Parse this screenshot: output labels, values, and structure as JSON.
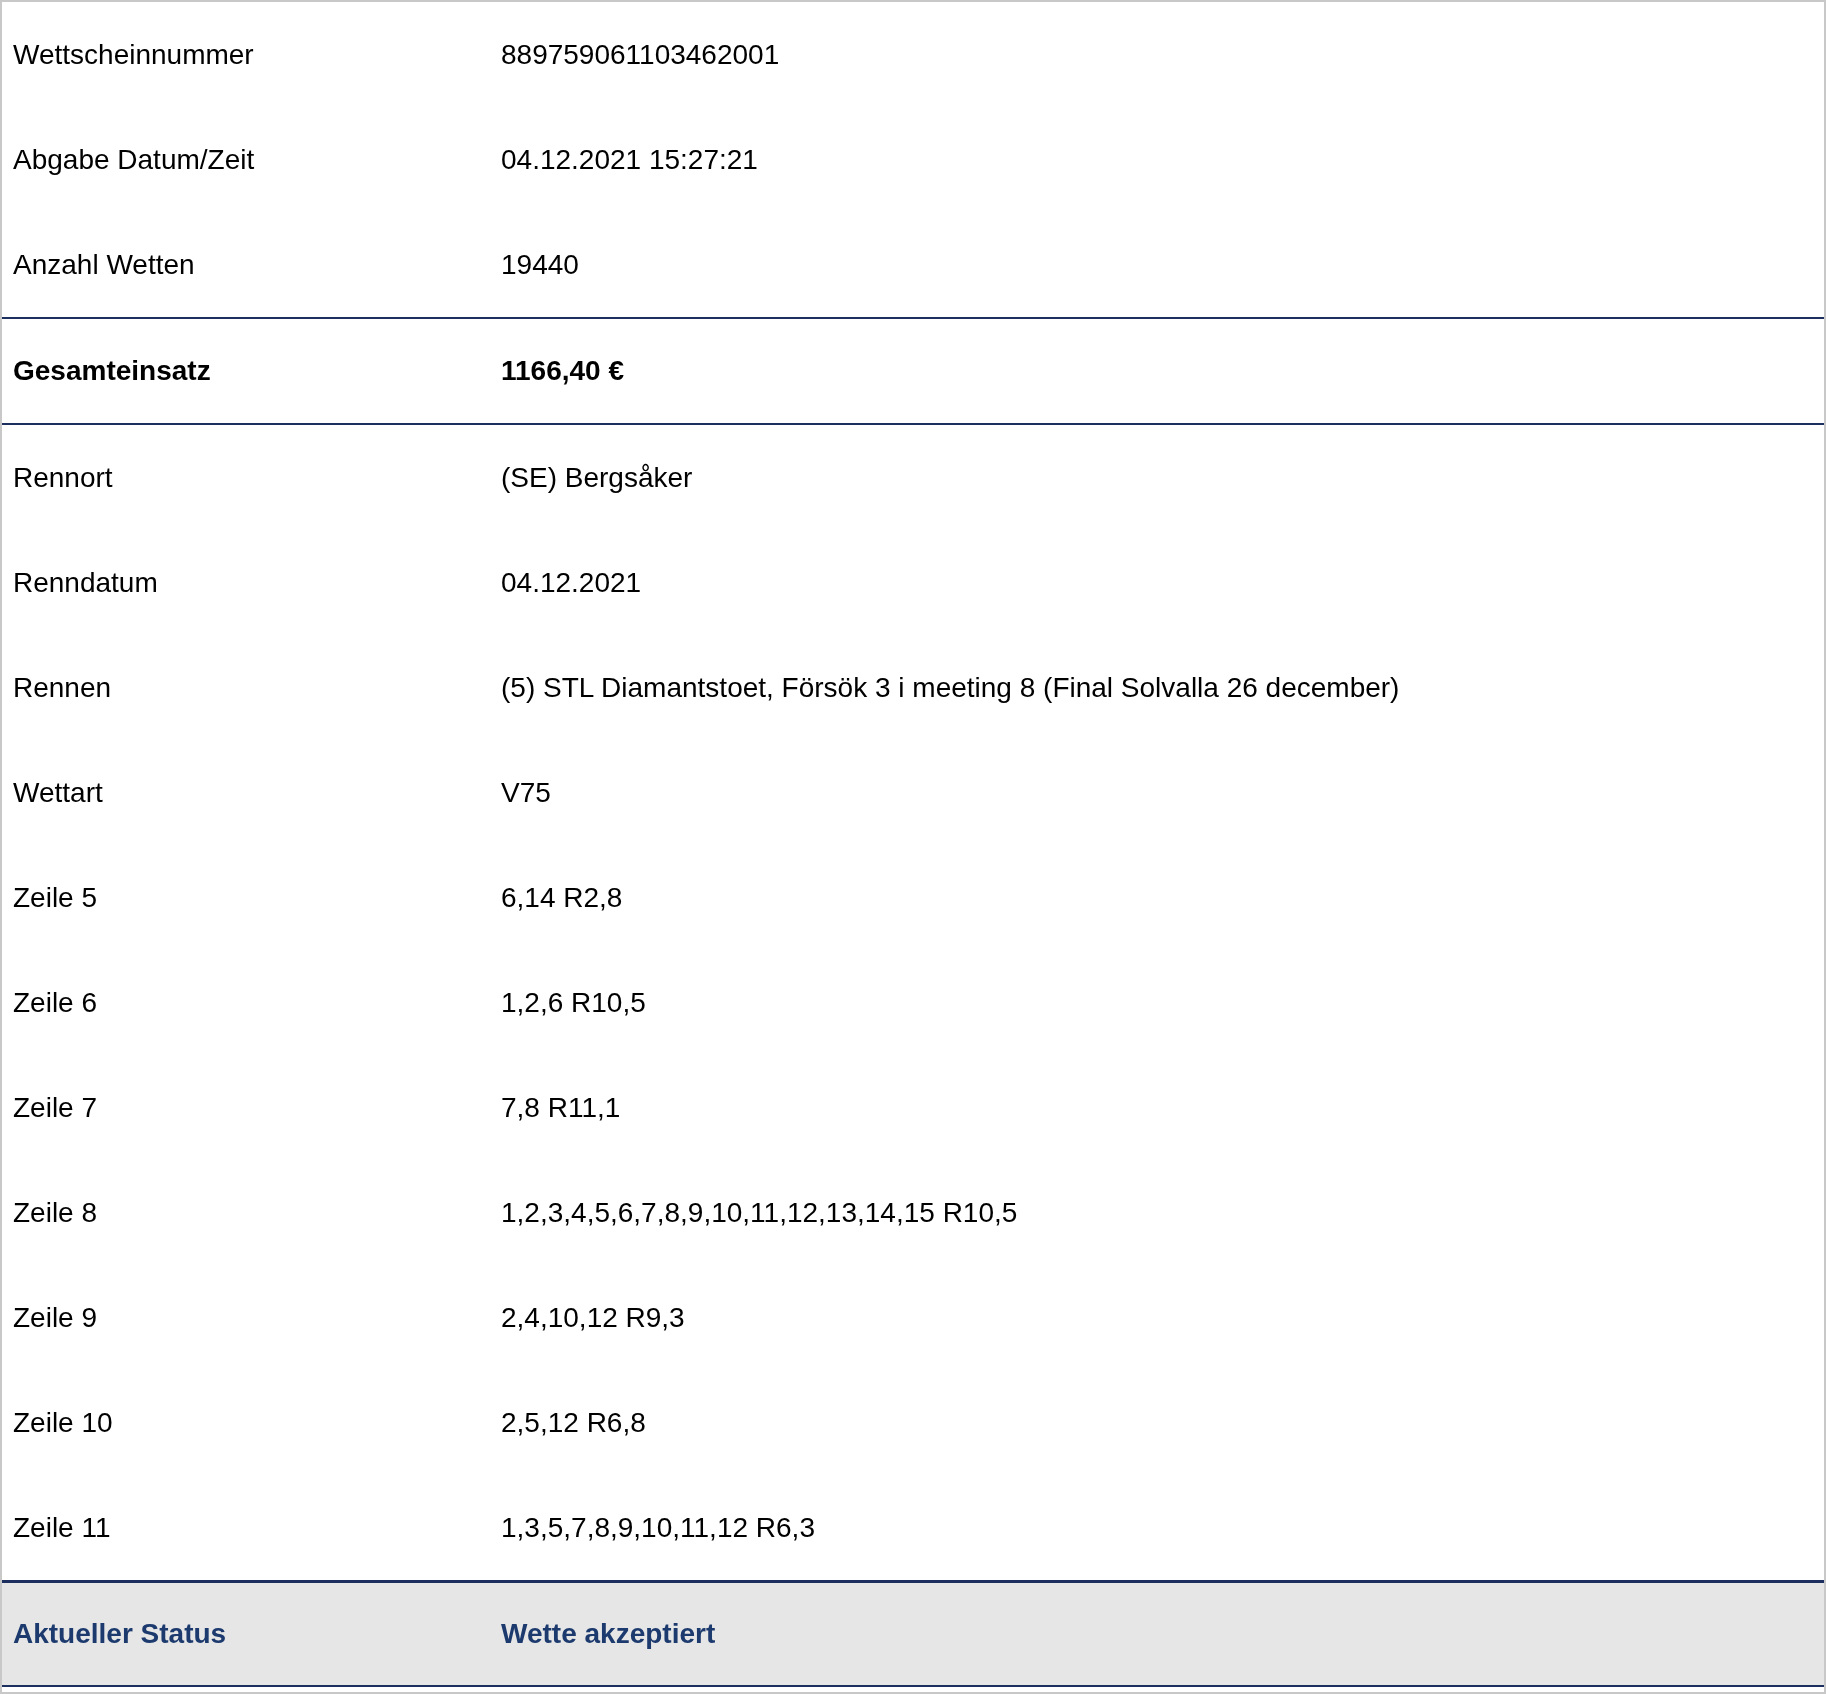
{
  "rows": [
    {
      "kind": "normal",
      "label": "Wettscheinnummer",
      "value": "889759061103462001"
    },
    {
      "kind": "normal",
      "label": "Abgabe Datum/Zeit",
      "value": "04.12.2021 15:27:21"
    },
    {
      "kind": "normal",
      "label": "Anzahl Wetten",
      "value": "19440"
    },
    {
      "kind": "total",
      "label": "Gesamteinsatz",
      "value": "1166,40 €"
    },
    {
      "kind": "normal",
      "label": "Rennort",
      "value": "(SE) Bergsåker"
    },
    {
      "kind": "normal",
      "label": "Renndatum",
      "value": "04.12.2021"
    },
    {
      "kind": "normal",
      "label": "Rennen",
      "value": "(5) STL Diamantstoet, Försök 3 i meeting 8 (Final Solvalla 26 december)"
    },
    {
      "kind": "normal",
      "label": "Wettart",
      "value": "V75"
    },
    {
      "kind": "normal",
      "label": "Zeile 5",
      "value": "6,14 R2,8"
    },
    {
      "kind": "normal",
      "label": "Zeile 6",
      "value": "1,2,6 R10,5"
    },
    {
      "kind": "normal",
      "label": "Zeile 7",
      "value": "7,8 R11,1"
    },
    {
      "kind": "normal",
      "label": "Zeile 8",
      "value": "1,2,3,4,5,6,7,8,9,10,11,12,13,14,15 R10,5"
    },
    {
      "kind": "normal",
      "label": "Zeile 9",
      "value": "2,4,10,12 R9,3"
    },
    {
      "kind": "normal",
      "label": "Zeile 10",
      "value": "2,5,12 R6,8"
    },
    {
      "kind": "normal",
      "label": "Zeile 11",
      "value": "1,3,5,7,8,9,10,11,12 R6,3"
    },
    {
      "kind": "status",
      "label": "Aktueller Status",
      "value": "Wette akzeptiert"
    }
  ]
}
